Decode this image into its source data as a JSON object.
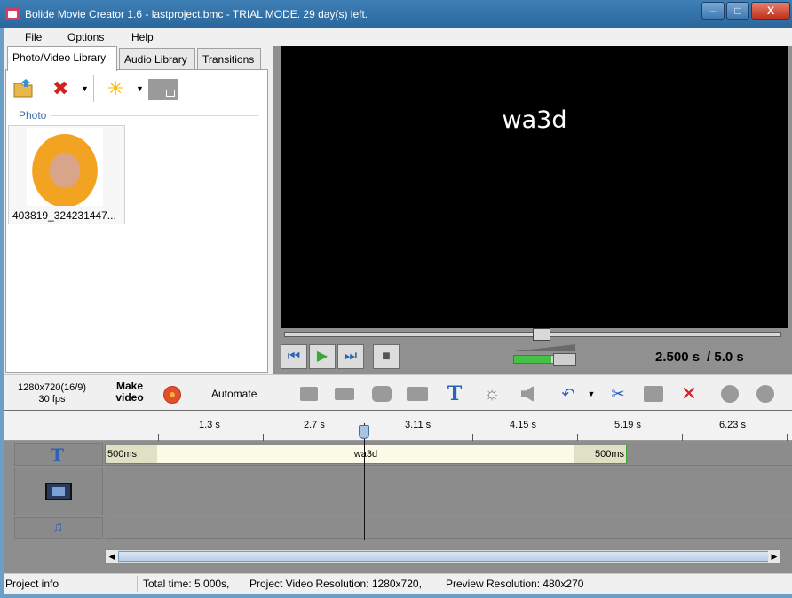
{
  "window": {
    "title": "Bolide Movie Creator 1.6 - lastproject.bmc  - TRIAL MODE. 29 day(s) left.",
    "min_label": "–",
    "max_label": "□",
    "close_label": "X"
  },
  "menu": [
    "File",
    "Options",
    "Help"
  ],
  "library": {
    "tabs": [
      "Photo/Video Library",
      "Audio Library",
      "Transitions"
    ],
    "active_tab": "Photo/Video Library",
    "icons": [
      "folder-add-icon",
      "delete-icon",
      "dropdown-arrow-icon",
      "effects-star-icon",
      "slide-icon"
    ],
    "delete_glyph": "✖",
    "star_glyph": "✳",
    "dropdown_glyph": "▼",
    "section": "Photo",
    "items": [
      {
        "caption": "403819_324231447..."
      }
    ]
  },
  "preview": {
    "overlay_text": "wa3d",
    "current_time": "2.500 s",
    "total_time": "/ 5.0 s",
    "progress": 0.5,
    "volume": 0.62,
    "buttons": {
      "first": "⏮",
      "play": "▶",
      "last": "⏭",
      "stop": "■"
    }
  },
  "toolbar": {
    "resolution": "1280x720(16/9)",
    "fps": "30 fps",
    "make_video": "Make video",
    "automate": "Automate",
    "text_glyph": "T",
    "undo_glyph": "↶",
    "dropdown_glyph": "▼",
    "cut_glyph": "✂",
    "delete_glyph": "✕",
    "brightness_glyph": "☼"
  },
  "timeline": {
    "ruler": [
      "1.3 s",
      "2.7 s",
      "3.11 s",
      "4.15 s",
      "5.19 s",
      "6.23 s"
    ],
    "tracks": [
      {
        "type": "text",
        "icon": "text-track-icon",
        "glyph": "T"
      },
      {
        "type": "video",
        "icon": "film-icon"
      },
      {
        "type": "audio",
        "icon": "music-icon",
        "glyph": "♫"
      }
    ],
    "text_clip": {
      "label": "wa3d",
      "fade_in": "500ms",
      "fade_out": "500ms"
    },
    "playhead_time": "2.500 s"
  },
  "status": {
    "project_info": "Project info",
    "total_time": "Total time: 5.000s,",
    "project_resolution": "Project Video Resolution:   1280x720,",
    "preview_resolution": "Preview Resolution:   480x270"
  },
  "colors": {
    "accent": "#2a62b8",
    "delete": "#d32020",
    "clip_border": "#3ca23c"
  }
}
